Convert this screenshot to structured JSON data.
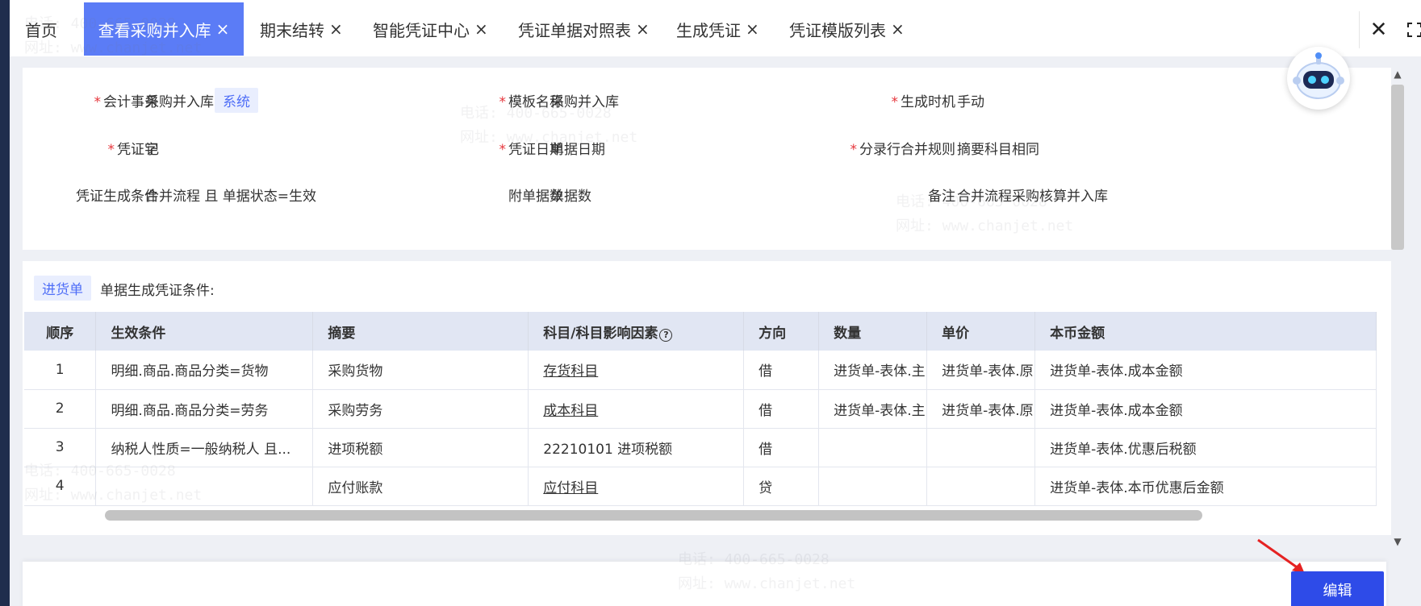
{
  "tabs": [
    {
      "label": "首页",
      "closable": false,
      "active": false
    },
    {
      "label": "查看采购并入库",
      "closable": true,
      "active": true
    },
    {
      "label": "期末结转",
      "closable": true,
      "active": false
    },
    {
      "label": "智能凭证中心",
      "closable": true,
      "active": false
    },
    {
      "label": "凭证单据对照表",
      "closable": true,
      "active": false
    },
    {
      "label": "生成凭证",
      "closable": true,
      "active": false
    },
    {
      "label": "凭证模版列表",
      "closable": true,
      "active": false
    }
  ],
  "tab_close_glyph": "×",
  "window_controls": {
    "close_glyph": "✕"
  },
  "form": {
    "accounting_event": {
      "label": "会计事务",
      "value": "采购并入库",
      "tag": "系统"
    },
    "template_name": {
      "label": "模板名称",
      "value": "采购并入库"
    },
    "generate_timing": {
      "label": "生成时机",
      "value": "手动"
    },
    "voucher_word": {
      "label": "凭证字",
      "value": "记"
    },
    "voucher_date": {
      "label": "凭证日期",
      "value": "单据日期"
    },
    "merge_rule": {
      "label": "分录行合并规则",
      "value": "摘要科目相同"
    },
    "generate_condition": {
      "label": "凭证生成条件",
      "value": "合并流程 且 单据状态=生效"
    },
    "attachment_count": {
      "label": "附单据数",
      "value": "单据数"
    },
    "remark": {
      "label": "备注",
      "value": "合并流程采购核算并入库"
    }
  },
  "detail": {
    "doc_tag": "进货单",
    "condition_label": "单据生成凭证条件:",
    "columns": [
      "顺序",
      "生效条件",
      "摘要",
      "科目/科目影响因素",
      "方向",
      "数量",
      "单价",
      "本币金额"
    ],
    "question_glyph": "?",
    "rows": [
      {
        "seq": "1",
        "condition": "明细.商品.商品分类=货物",
        "summary": "采购货物",
        "subject": "存货科目",
        "subject_link": true,
        "direction": "借",
        "qty": "进货单-表体.主",
        "price": "进货单-表体.原",
        "amount": "进货单-表体.成本金额"
      },
      {
        "seq": "2",
        "condition": "明细.商品.商品分类=劳务",
        "summary": "采购劳务",
        "subject": "成本科目",
        "subject_link": true,
        "direction": "借",
        "qty": "进货单-表体.主",
        "price": "进货单-表体.原",
        "amount": "进货单-表体.成本金额"
      },
      {
        "seq": "3",
        "condition": "纳税人性质=一般纳税人 且...",
        "summary": "进项税额",
        "subject": "22210101 进项税额",
        "subject_link": false,
        "direction": "借",
        "qty": "",
        "price": "",
        "amount": "进货单-表体.优惠后税额"
      },
      {
        "seq": "4",
        "condition": "",
        "summary": "应付账款",
        "subject": "应付科目",
        "subject_link": true,
        "direction": "贷",
        "qty": "",
        "price": "",
        "amount": "进货单-表体.本币优惠后金额"
      }
    ]
  },
  "footer": {
    "edit_label": "编辑"
  },
  "watermark": {
    "phone": "电话: 400-665-0028",
    "site": "网址: www.chanjet.net"
  },
  "colors": {
    "accent": "#5b7cf6",
    "primary_button": "#2e4be8",
    "required": "#e6353b",
    "tag_bg": "#e9eefe"
  }
}
